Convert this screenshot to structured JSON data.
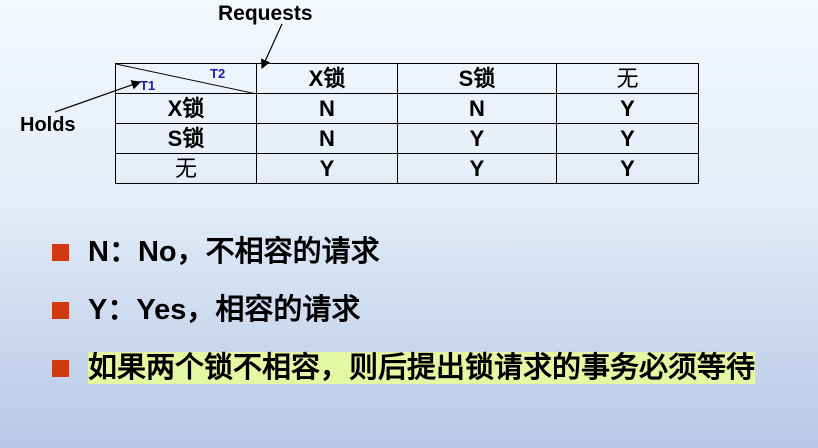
{
  "labels": {
    "requests": "Requests",
    "holds": "Holds",
    "t1": "T1",
    "t2": "T2"
  },
  "table": {
    "columns": [
      "X锁",
      "S锁",
      "无"
    ],
    "rows": [
      {
        "label": "X锁",
        "cells": [
          "N",
          "N",
          "Y"
        ]
      },
      {
        "label": "S锁",
        "cells": [
          "N",
          "Y",
          "Y"
        ]
      },
      {
        "label": "无",
        "cells": [
          "Y",
          "Y",
          "Y"
        ]
      }
    ]
  },
  "notes": [
    {
      "text": "N：No，不相容的请求"
    },
    {
      "text": "Y：Yes，相容的请求"
    },
    {
      "text": "如果两个锁不相容，则后提出锁请求的事务必须等待"
    }
  ],
  "colors": {
    "bullet": "#d13b14",
    "highlight": "#e6f7a3",
    "t_label": "#1c1ca8"
  }
}
